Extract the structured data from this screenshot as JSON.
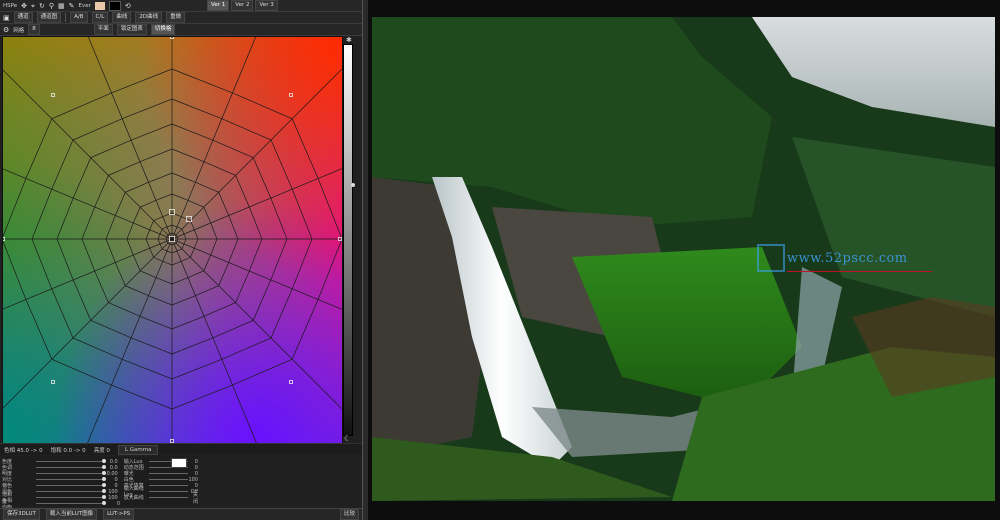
{
  "toolbar": {
    "mode_label": "HSPe",
    "ever_label": "Ever",
    "versions": [
      "Ver 1",
      "Ver 2",
      "Ver 3"
    ],
    "row2": [
      "通道",
      "通道图",
      "A/B",
      "C/L",
      "曲线",
      "2D曲线",
      "重做"
    ],
    "row3": [
      "网格",
      "8",
      "平面",
      "锁定图表",
      "切换格"
    ]
  },
  "status": {
    "hue": "色相 45.0 -> 0",
    "sat": "饱和 0.0 -> 0",
    "bright": "亮度 0",
    "gamma": "L Gamma"
  },
  "controls": {
    "left": [
      {
        "name": "色度",
        "value": "0.0"
      },
      {
        "name": "色调",
        "value": "0.0"
      },
      {
        "name": "明度",
        "value": "0.00"
      },
      {
        "name": "对比",
        "value": "0"
      },
      {
        "name": "偏色",
        "value": "0"
      },
      {
        "name": "混色",
        "value": "100"
      },
      {
        "name": "饱和度",
        "value": "100"
      },
      {
        "name": "色相均衡",
        "value": "0"
      }
    ],
    "right": [
      {
        "name": "输入Lux",
        "value": "0"
      },
      {
        "name": "动态范围",
        "value": "0"
      },
      {
        "name": "曝光",
        "value": "0"
      },
      {
        "name": "白色",
        "value": "100"
      },
      {
        "name": "高光恢复",
        "value": "0"
      },
      {
        "name": "输入曲线Log",
        "value": "Off"
      },
      {
        "name": "放大曲线",
        "value": "关闭"
      }
    ]
  },
  "bottom_bar": [
    "保存3DLUT",
    "载入当前LUT图像",
    "LUT->PS",
    "比较"
  ],
  "watermark": {
    "text": "www.52pscc.com"
  },
  "colors": {
    "accent": "#3ca0f0",
    "panel": "#202020",
    "line": "#c0102a"
  }
}
